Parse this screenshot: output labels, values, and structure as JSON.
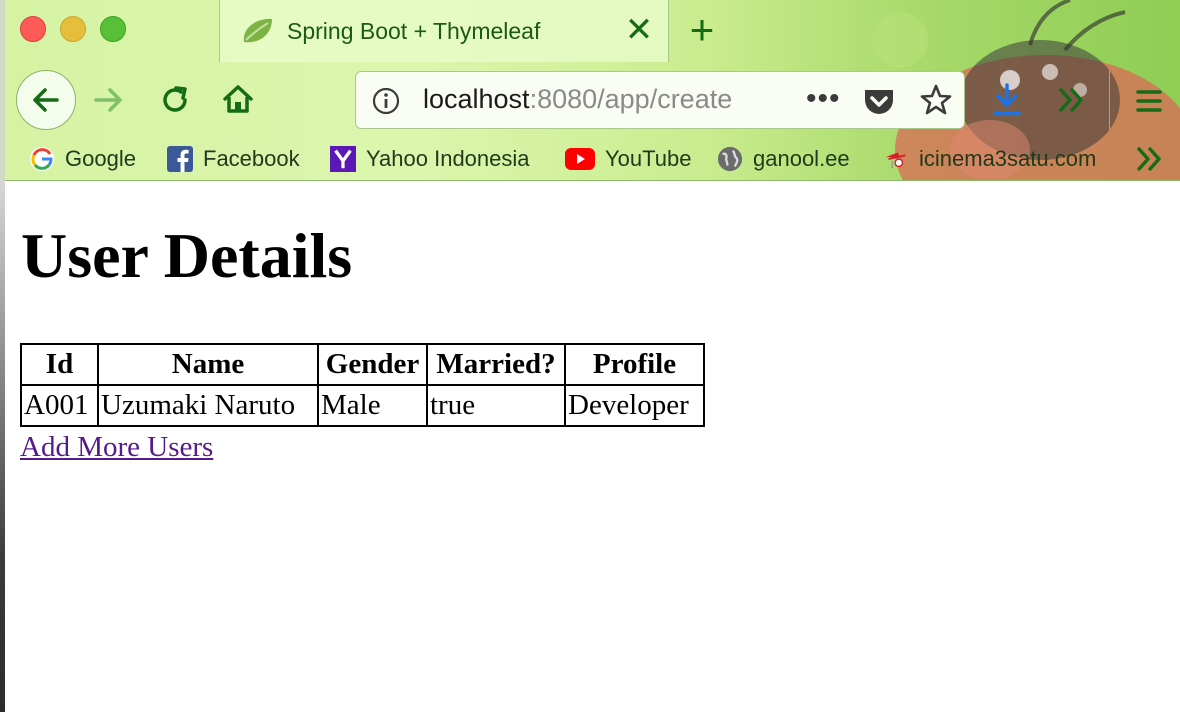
{
  "tab": {
    "title": "Spring Boot + Thymeleaf",
    "close_glyph": "✕",
    "new_tab_glyph": "+"
  },
  "urlbar": {
    "host": "localhost",
    "path": ":8080/app/create",
    "more_glyph": "•••"
  },
  "bookmarks": [
    {
      "label": "Google",
      "icon": "google-icon"
    },
    {
      "label": "Facebook",
      "icon": "facebook-icon"
    },
    {
      "label": "Yahoo Indonesia",
      "icon": "yahoo-icon"
    },
    {
      "label": "YouTube",
      "icon": "youtube-icon"
    },
    {
      "label": "ganool.ee",
      "icon": "globe-icon"
    },
    {
      "label": "icinema3satu.com",
      "icon": "cinema-icon"
    }
  ],
  "colors": {
    "link_visited": "#551a8b",
    "chrome_green": "#156b16"
  },
  "page": {
    "heading": "User Details",
    "table": {
      "headers": [
        "Id",
        "Name",
        "Gender",
        "Married?",
        "Profile"
      ],
      "rows": [
        [
          "A001",
          "Uzumaki Naruto",
          "Male",
          "true",
          "Developer"
        ]
      ]
    },
    "add_link": "Add More Users"
  }
}
